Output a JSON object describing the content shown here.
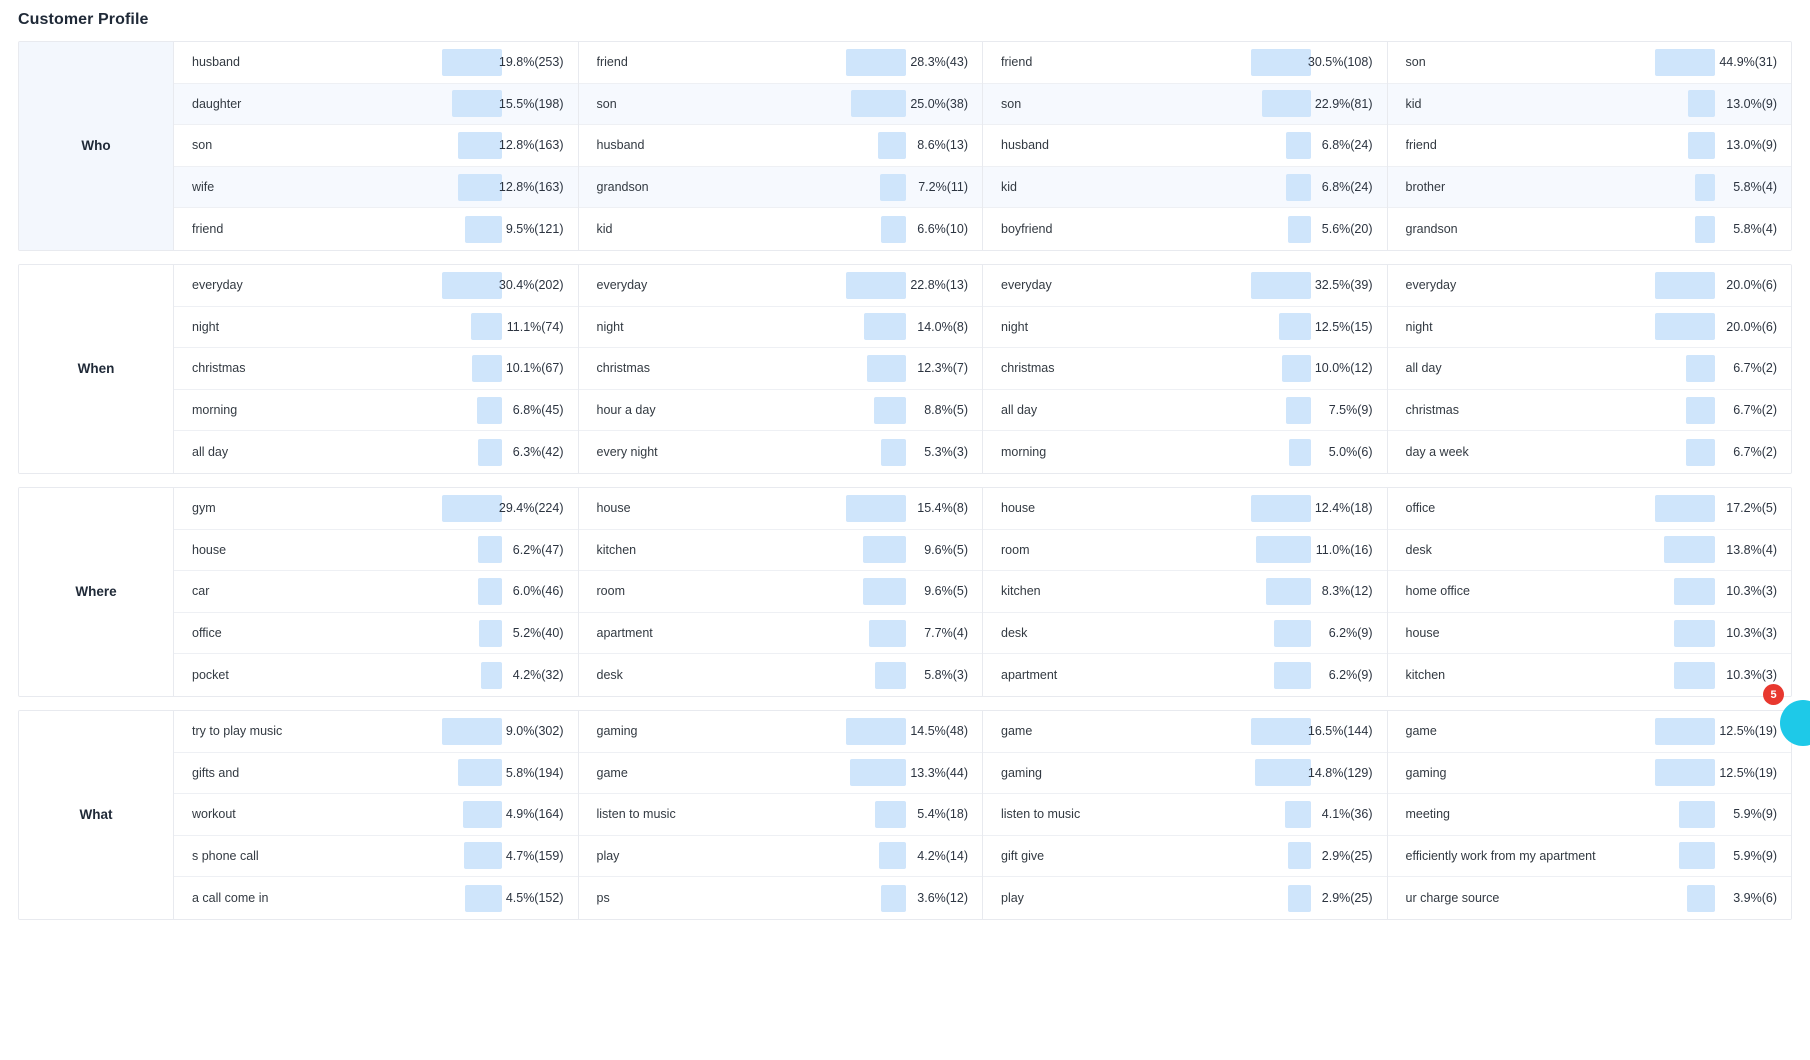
{
  "header": {
    "title": "Customer Profile"
  },
  "float_widget": {
    "badge_count": "5",
    "badge_color": "#e8382f",
    "button_color": "#1ec9e8"
  },
  "theme": {
    "bar_color": "#cfe5fb",
    "highlight_row": "#f6f9fe",
    "label_cell": "#f3f7fd",
    "border": "#e8eaef"
  },
  "chart_data": {
    "type": "bar",
    "title": "Customer Profile",
    "layout": "4 sections (Who/When/Where/What) x 4 columns x 5 rows of horizontal percentage bars",
    "sections": [
      {
        "label": "Who",
        "highlighted": true,
        "columns": [
          {
            "rows": [
              {
                "label": "husband",
                "pct": 19.8,
                "count": 253,
                "value": "19.8%(253)"
              },
              {
                "label": "daughter",
                "pct": 15.5,
                "count": 198,
                "value": "15.5%(198)"
              },
              {
                "label": "son",
                "pct": 12.8,
                "count": 163,
                "value": "12.8%(163)"
              },
              {
                "label": "wife",
                "pct": 12.8,
                "count": 163,
                "value": "12.8%(163)"
              },
              {
                "label": "friend",
                "pct": 9.5,
                "count": 121,
                "value": "9.5%(121)"
              }
            ]
          },
          {
            "rows": [
              {
                "label": "friend",
                "pct": 28.3,
                "count": 43,
                "value": "28.3%(43)"
              },
              {
                "label": "son",
                "pct": 25.0,
                "count": 38,
                "value": "25.0%(38)"
              },
              {
                "label": "husband",
                "pct": 8.6,
                "count": 13,
                "value": "8.6%(13)"
              },
              {
                "label": "grandson",
                "pct": 7.2,
                "count": 11,
                "value": "7.2%(11)"
              },
              {
                "label": "kid",
                "pct": 6.6,
                "count": 10,
                "value": "6.6%(10)"
              }
            ]
          },
          {
            "rows": [
              {
                "label": "friend",
                "pct": 30.5,
                "count": 108,
                "value": "30.5%(108)"
              },
              {
                "label": "son",
                "pct": 22.9,
                "count": 81,
                "value": "22.9%(81)"
              },
              {
                "label": "husband",
                "pct": 6.8,
                "count": 24,
                "value": "6.8%(24)"
              },
              {
                "label": "kid",
                "pct": 6.8,
                "count": 24,
                "value": "6.8%(24)"
              },
              {
                "label": "boyfriend",
                "pct": 5.6,
                "count": 20,
                "value": "5.6%(20)"
              }
            ]
          },
          {
            "rows": [
              {
                "label": "son",
                "pct": 44.9,
                "count": 31,
                "value": "44.9%(31)"
              },
              {
                "label": "kid",
                "pct": 13.0,
                "count": 9,
                "value": "13.0%(9)"
              },
              {
                "label": "friend",
                "pct": 13.0,
                "count": 9,
                "value": "13.0%(9)"
              },
              {
                "label": "brother",
                "pct": 5.8,
                "count": 4,
                "value": "5.8%(4)"
              },
              {
                "label": "grandson",
                "pct": 5.8,
                "count": 4,
                "value": "5.8%(4)"
              }
            ]
          }
        ]
      },
      {
        "label": "When",
        "highlighted": false,
        "columns": [
          {
            "rows": [
              {
                "label": "everyday",
                "pct": 30.4,
                "count": 202,
                "value": "30.4%(202)"
              },
              {
                "label": "night",
                "pct": 11.1,
                "count": 74,
                "value": "11.1%(74)"
              },
              {
                "label": "christmas",
                "pct": 10.1,
                "count": 67,
                "value": "10.1%(67)"
              },
              {
                "label": "morning",
                "pct": 6.8,
                "count": 45,
                "value": "6.8%(45)"
              },
              {
                "label": "all day",
                "pct": 6.3,
                "count": 42,
                "value": "6.3%(42)"
              }
            ]
          },
          {
            "rows": [
              {
                "label": "everyday",
                "pct": 22.8,
                "count": 13,
                "value": "22.8%(13)"
              },
              {
                "label": "night",
                "pct": 14.0,
                "count": 8,
                "value": "14.0%(8)"
              },
              {
                "label": "christmas",
                "pct": 12.3,
                "count": 7,
                "value": "12.3%(7)"
              },
              {
                "label": "hour a day",
                "pct": 8.8,
                "count": 5,
                "value": "8.8%(5)"
              },
              {
                "label": "every night",
                "pct": 5.3,
                "count": 3,
                "value": "5.3%(3)"
              }
            ]
          },
          {
            "rows": [
              {
                "label": "everyday",
                "pct": 32.5,
                "count": 39,
                "value": "32.5%(39)"
              },
              {
                "label": "night",
                "pct": 12.5,
                "count": 15,
                "value": "12.5%(15)"
              },
              {
                "label": "christmas",
                "pct": 10.0,
                "count": 12,
                "value": "10.0%(12)"
              },
              {
                "label": "all day",
                "pct": 7.5,
                "count": 9,
                "value": "7.5%(9)"
              },
              {
                "label": "morning",
                "pct": 5.0,
                "count": 6,
                "value": "5.0%(6)"
              }
            ]
          },
          {
            "rows": [
              {
                "label": "everyday",
                "pct": 20.0,
                "count": 6,
                "value": "20.0%(6)"
              },
              {
                "label": "night",
                "pct": 20.0,
                "count": 6,
                "value": "20.0%(6)"
              },
              {
                "label": "all day",
                "pct": 6.7,
                "count": 2,
                "value": "6.7%(2)"
              },
              {
                "label": "christmas",
                "pct": 6.7,
                "count": 2,
                "value": "6.7%(2)"
              },
              {
                "label": "day a week",
                "pct": 6.7,
                "count": 2,
                "value": "6.7%(2)"
              }
            ]
          }
        ]
      },
      {
        "label": "Where",
        "highlighted": false,
        "columns": [
          {
            "rows": [
              {
                "label": "gym",
                "pct": 29.4,
                "count": 224,
                "value": "29.4%(224)"
              },
              {
                "label": "house",
                "pct": 6.2,
                "count": 47,
                "value": "6.2%(47)"
              },
              {
                "label": "car",
                "pct": 6.0,
                "count": 46,
                "value": "6.0%(46)"
              },
              {
                "label": "office",
                "pct": 5.2,
                "count": 40,
                "value": "5.2%(40)"
              },
              {
                "label": "pocket",
                "pct": 4.2,
                "count": 32,
                "value": "4.2%(32)"
              }
            ]
          },
          {
            "rows": [
              {
                "label": "house",
                "pct": 15.4,
                "count": 8,
                "value": "15.4%(8)"
              },
              {
                "label": "kitchen",
                "pct": 9.6,
                "count": 5,
                "value": "9.6%(5)"
              },
              {
                "label": "room",
                "pct": 9.6,
                "count": 5,
                "value": "9.6%(5)"
              },
              {
                "label": "apartment",
                "pct": 7.7,
                "count": 4,
                "value": "7.7%(4)"
              },
              {
                "label": "desk",
                "pct": 5.8,
                "count": 3,
                "value": "5.8%(3)"
              }
            ]
          },
          {
            "rows": [
              {
                "label": "house",
                "pct": 12.4,
                "count": 18,
                "value": "12.4%(18)"
              },
              {
                "label": "room",
                "pct": 11.0,
                "count": 16,
                "value": "11.0%(16)"
              },
              {
                "label": "kitchen",
                "pct": 8.3,
                "count": 12,
                "value": "8.3%(12)"
              },
              {
                "label": "desk",
                "pct": 6.2,
                "count": 9,
                "value": "6.2%(9)"
              },
              {
                "label": "apartment",
                "pct": 6.2,
                "count": 9,
                "value": "6.2%(9)"
              }
            ]
          },
          {
            "rows": [
              {
                "label": "office",
                "pct": 17.2,
                "count": 5,
                "value": "17.2%(5)"
              },
              {
                "label": "desk",
                "pct": 13.8,
                "count": 4,
                "value": "13.8%(4)"
              },
              {
                "label": "home office",
                "pct": 10.3,
                "count": 3,
                "value": "10.3%(3)"
              },
              {
                "label": "house",
                "pct": 10.3,
                "count": 3,
                "value": "10.3%(3)"
              },
              {
                "label": "kitchen",
                "pct": 10.3,
                "count": 3,
                "value": "10.3%(3)"
              }
            ]
          }
        ]
      },
      {
        "label": "What",
        "highlighted": false,
        "columns": [
          {
            "rows": [
              {
                "label": "try to play music",
                "pct": 9.0,
                "count": 302,
                "value": "9.0%(302)"
              },
              {
                "label": "gifts and",
                "pct": 5.8,
                "count": 194,
                "value": "5.8%(194)"
              },
              {
                "label": "workout",
                "pct": 4.9,
                "count": 164,
                "value": "4.9%(164)"
              },
              {
                "label": "s phone call",
                "pct": 4.7,
                "count": 159,
                "value": "4.7%(159)"
              },
              {
                "label": "a call come in",
                "pct": 4.5,
                "count": 152,
                "value": "4.5%(152)"
              }
            ]
          },
          {
            "rows": [
              {
                "label": "gaming",
                "pct": 14.5,
                "count": 48,
                "value": "14.5%(48)"
              },
              {
                "label": "game",
                "pct": 13.3,
                "count": 44,
                "value": "13.3%(44)"
              },
              {
                "label": "listen to music",
                "pct": 5.4,
                "count": 18,
                "value": "5.4%(18)"
              },
              {
                "label": "play",
                "pct": 4.2,
                "count": 14,
                "value": "4.2%(14)"
              },
              {
                "label": "ps",
                "pct": 3.6,
                "count": 12,
                "value": "3.6%(12)"
              }
            ]
          },
          {
            "rows": [
              {
                "label": "game",
                "pct": 16.5,
                "count": 144,
                "value": "16.5%(144)"
              },
              {
                "label": "gaming",
                "pct": 14.8,
                "count": 129,
                "value": "14.8%(129)"
              },
              {
                "label": "listen to music",
                "pct": 4.1,
                "count": 36,
                "value": "4.1%(36)"
              },
              {
                "label": "gift give",
                "pct": 2.9,
                "count": 25,
                "value": "2.9%(25)"
              },
              {
                "label": "play",
                "pct": 2.9,
                "count": 25,
                "value": "2.9%(25)"
              }
            ]
          },
          {
            "rows": [
              {
                "label": "game",
                "pct": 12.5,
                "count": 19,
                "value": "12.5%(19)"
              },
              {
                "label": "gaming",
                "pct": 12.5,
                "count": 19,
                "value": "12.5%(19)"
              },
              {
                "label": "meeting",
                "pct": 5.9,
                "count": 9,
                "value": "5.9%(9)"
              },
              {
                "label": "efficiently work from my apartment",
                "pct": 5.9,
                "count": 9,
                "value": "5.9%(9)"
              },
              {
                "label": "ur charge source",
                "pct": 3.9,
                "count": 6,
                "value": "3.9%(6)"
              }
            ]
          }
        ]
      }
    ]
  }
}
